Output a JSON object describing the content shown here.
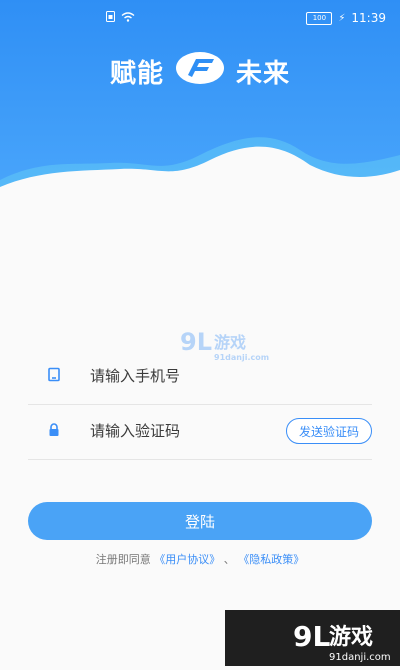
{
  "status_bar": {
    "time": "11:39",
    "battery": "100"
  },
  "brand": {
    "left": "赋能",
    "right": "未来"
  },
  "phone_field": {
    "placeholder": "请输入手机号"
  },
  "code_field": {
    "placeholder": "请输入验证码"
  },
  "send_code_button": {
    "label": "发送验证码"
  },
  "login_button": {
    "label": "登陆"
  },
  "agreement": {
    "prefix": "注册即同意",
    "user_agreement": "《用户协议》",
    "separator": "、",
    "privacy_policy": "《隐私政策》"
  },
  "watermark": {
    "logo": "9L游戏",
    "url": "91danji.com"
  },
  "colors": {
    "primary": "#3a8ef7",
    "header_top": "#2f8ff5",
    "button": "#4aa3f6"
  }
}
